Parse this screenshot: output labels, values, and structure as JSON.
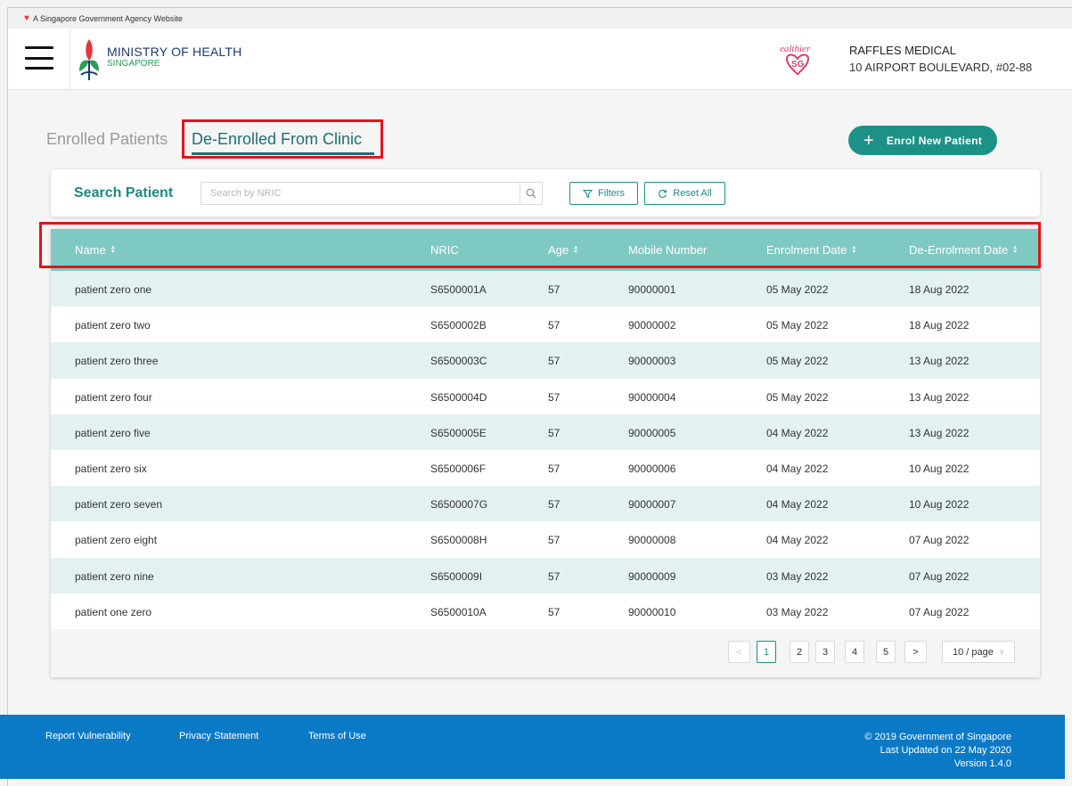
{
  "gov_bar": {
    "text": "A Singapore Government Agency Website"
  },
  "header": {
    "ministry_title": "MINISTRY OF HEALTH",
    "ministry_sub": "SINGAPORE",
    "clinic_name": "RAFFLES MEDICAL",
    "clinic_address": "10 AIRPORT BOULEVARD, #02-88"
  },
  "tabs": {
    "enrolled": "Enrolled Patients",
    "de_enrolled": "De-Enrolled From Clinic",
    "active": "de_enrolled"
  },
  "enrol_button": {
    "label": "Enrol New Patient"
  },
  "search": {
    "label": "Search Patient",
    "placeholder": "Search by NRIC",
    "value": "",
    "filters_label": "Filters",
    "reset_label": "Reset All"
  },
  "table": {
    "columns": {
      "name": "Name",
      "nric": "NRIC",
      "age": "Age",
      "mobile": "Mobile Number",
      "enrolment_date": "Enrolment Date",
      "de_enrolment_date": "De-Enrolment Date"
    },
    "rows": [
      {
        "name": "patient zero one",
        "nric": "S6500001A",
        "age": "57",
        "mobile": "90000001",
        "enrolment_date": "05 May 2022",
        "de_enrolment_date": "18 Aug 2022"
      },
      {
        "name": "patient zero two",
        "nric": "S6500002B",
        "age": "57",
        "mobile": "90000002",
        "enrolment_date": "05 May 2022",
        "de_enrolment_date": "18 Aug 2022"
      },
      {
        "name": "patient zero three",
        "nric": "S6500003C",
        "age": "57",
        "mobile": "90000003",
        "enrolment_date": "05 May 2022",
        "de_enrolment_date": "13 Aug 2022"
      },
      {
        "name": "patient zero four",
        "nric": "S6500004D",
        "age": "57",
        "mobile": "90000004",
        "enrolment_date": "05 May 2022",
        "de_enrolment_date": "13 Aug 2022"
      },
      {
        "name": "patient zero five",
        "nric": "S6500005E",
        "age": "57",
        "mobile": "90000005",
        "enrolment_date": "04 May 2022",
        "de_enrolment_date": "13 Aug 2022"
      },
      {
        "name": "patient zero six",
        "nric": "S6500006F",
        "age": "57",
        "mobile": "90000006",
        "enrolment_date": "04 May 2022",
        "de_enrolment_date": "10 Aug 2022"
      },
      {
        "name": "patient zero seven",
        "nric": "S6500007G",
        "age": "57",
        "mobile": "90000007",
        "enrolment_date": "04 May 2022",
        "de_enrolment_date": "10 Aug 2022"
      },
      {
        "name": "patient zero eight",
        "nric": "S6500008H",
        "age": "57",
        "mobile": "90000008",
        "enrolment_date": "04 May 2022",
        "de_enrolment_date": "07 Aug 2022"
      },
      {
        "name": "patient zero nine",
        "nric": "S6500009I",
        "age": "57",
        "mobile": "90000009",
        "enrolment_date": "03 May 2022",
        "de_enrolment_date": "07 Aug 2022"
      },
      {
        "name": "patient one zero",
        "nric": "S6500010A",
        "age": "57",
        "mobile": "90000010",
        "enrolment_date": "03 May 2022",
        "de_enrolment_date": "07 Aug 2022"
      }
    ]
  },
  "pagination": {
    "prev": "<",
    "next": ">",
    "pages": [
      "1",
      "2",
      "3",
      "4",
      "5"
    ],
    "current": "1",
    "page_size": "10 / page"
  },
  "footer": {
    "links": [
      "Report Vulnerability",
      "Privacy Statement",
      "Terms of Use"
    ],
    "copyright": "© 2019 Government of Singapore",
    "last_updated": "Last Updated on 22 May 2020",
    "version": "Version 1.4.0"
  },
  "colors": {
    "accent": "#1e9187",
    "table_header": "#7ecac2",
    "row_stripe": "#e4f1f1",
    "footer": "#0a7ac7",
    "highlight_box": "#e3141c"
  },
  "icons": [
    "lion-head-icon",
    "hamburger-menu-icon",
    "moh-logo-icon",
    "healthier-sg-logo-icon",
    "plus-icon",
    "search-icon",
    "filter-icon",
    "reset-icon",
    "sort-icon",
    "chevron-left-icon",
    "chevron-right-icon",
    "chevron-down-icon"
  ]
}
